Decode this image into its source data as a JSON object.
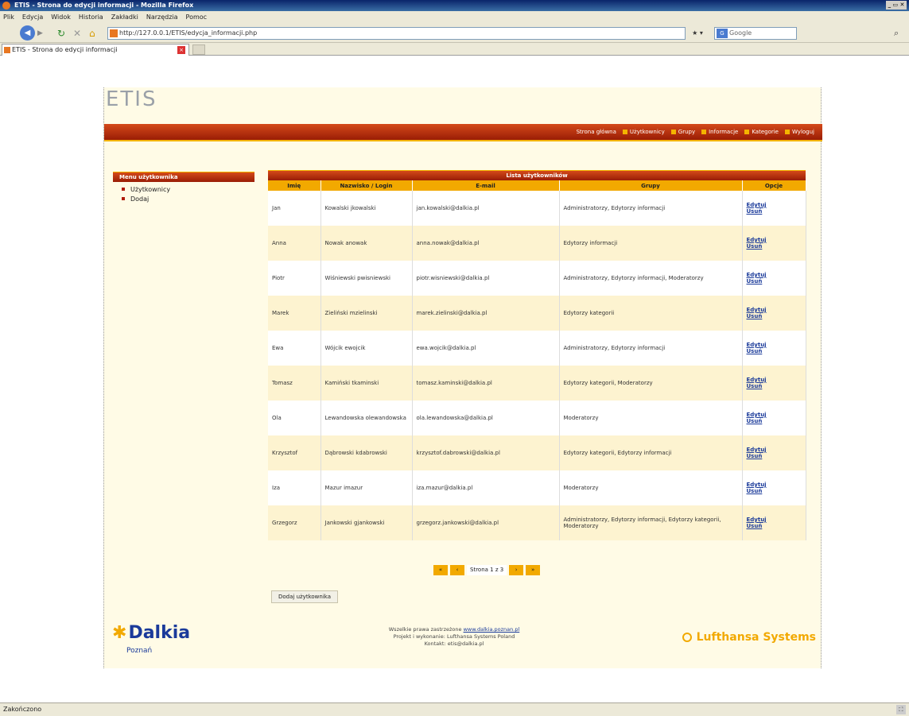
{
  "window": {
    "title": "ETIS - Strona do edycji informacji - Mozilla Firefox",
    "controls": "_ ▭ ✕"
  },
  "menu": [
    "Plik",
    "Edycja",
    "Widok",
    "Historia",
    "Zakładki",
    "Narzędzia",
    "Pomoc"
  ],
  "nav": {
    "url": "http://127.0.0.1/ETIS/edycja_informacji.php",
    "search_placeholder": "Google"
  },
  "tab": {
    "title": "ETIS - Strona do edycji informacji"
  },
  "page": {
    "logo": "ETIS",
    "topnav": [
      "Strona główna",
      "Użytkownicy",
      "Grupy",
      "Informacje",
      "Kategorie",
      "Wyloguj"
    ],
    "sidebar": {
      "title": "Menu użytkownika",
      "items": [
        "Użytkownicy",
        "Dodaj"
      ]
    },
    "table": {
      "title": "Lista użytkowników",
      "headers": [
        "Imię",
        "Nazwisko",
        "Login",
        "E-mail",
        "Grupy",
        "Opcje"
      ],
      "rows": [
        {
          "imie": "Jan",
          "nazwisko": "Kowalski",
          "login": "jkowalski",
          "email": "jan.kowalski@dalkia.pl",
          "grupy": "Administratorzy, Edytorzy informacji",
          "ops": [
            "Edytuj",
            "Usuń"
          ]
        },
        {
          "imie": "Anna",
          "nazwisko": "Nowak",
          "login": "anowak",
          "email": "anna.nowak@dalkia.pl",
          "grupy": "Edytorzy informacji",
          "ops": [
            "Edytuj",
            "Usuń"
          ]
        },
        {
          "imie": "Piotr",
          "nazwisko": "Wiśniewski",
          "login": "pwisniewski",
          "email": "piotr.wisniewski@dalkia.pl",
          "grupy": "Administratorzy, Edytorzy informacji, Moderatorzy",
          "ops": [
            "Edytuj",
            "Usuń"
          ]
        },
        {
          "imie": "Marek",
          "nazwisko": "Zieliński",
          "login": "mzielinski",
          "email": "marek.zielinski@dalkia.pl",
          "grupy": "Edytorzy kategorii",
          "ops": [
            "Edytuj",
            "Usuń"
          ]
        },
        {
          "imie": "Ewa",
          "nazwisko": "Wójcik",
          "login": "ewojcik",
          "email": "ewa.wojcik@dalkia.pl",
          "grupy": "Administratorzy, Edytorzy informacji",
          "ops": [
            "Edytuj",
            "Usuń"
          ]
        },
        {
          "imie": "Tomasz",
          "nazwisko": "Kamiński",
          "login": "tkaminski",
          "email": "tomasz.kaminski@dalkia.pl",
          "grupy": "Edytorzy kategorii, Moderatorzy",
          "ops": [
            "Edytuj",
            "Usuń"
          ]
        },
        {
          "imie": "Ola",
          "nazwisko": "Lewandowska",
          "login": "olewandowska",
          "email": "ola.lewandowska@dalkia.pl",
          "grupy": "Moderatorzy",
          "ops": [
            "Edytuj",
            "Usuń"
          ]
        },
        {
          "imie": "Krzysztof",
          "nazwisko": "Dąbrowski",
          "login": "kdabrowski",
          "email": "krzysztof.dabrowski@dalkia.pl",
          "grupy": "Edytorzy kategorii, Edytorzy informacji",
          "ops": [
            "Edytuj",
            "Usuń"
          ]
        },
        {
          "imie": "Iza",
          "nazwisko": "Mazur",
          "login": "imazur",
          "email": "iza.mazur@dalkia.pl",
          "grupy": "Moderatorzy",
          "ops": [
            "Edytuj",
            "Usuń"
          ]
        },
        {
          "imie": "Grzegorz",
          "nazwisko": "Jankowski",
          "login": "gjankowski",
          "email": "grzegorz.jankowski@dalkia.pl",
          "grupy": "Administratorzy, Edytorzy informacji, Edytorzy kategorii, Moderatorzy",
          "ops": [
            "Edytuj",
            "Usuń"
          ]
        }
      ]
    },
    "pagination": {
      "first": "«",
      "prev": "‹",
      "info": "Strona 1 z 3",
      "next": "›",
      "last": "»"
    },
    "add_button": "Dodaj użytkownika",
    "footer": {
      "brand_left": "Dalkia",
      "brand_left_sub": "Poznań",
      "line1": "Wszelkie prawa zastrzeżone",
      "link": "www.dalkia.poznan.pl",
      "line2": "Projekt i wykonanie: Lufthansa Systems Poland",
      "line3": "Kontakt: etis@dalkia.pl",
      "brand_right": "Lufthansa Systems"
    }
  },
  "status": "Zakończono"
}
